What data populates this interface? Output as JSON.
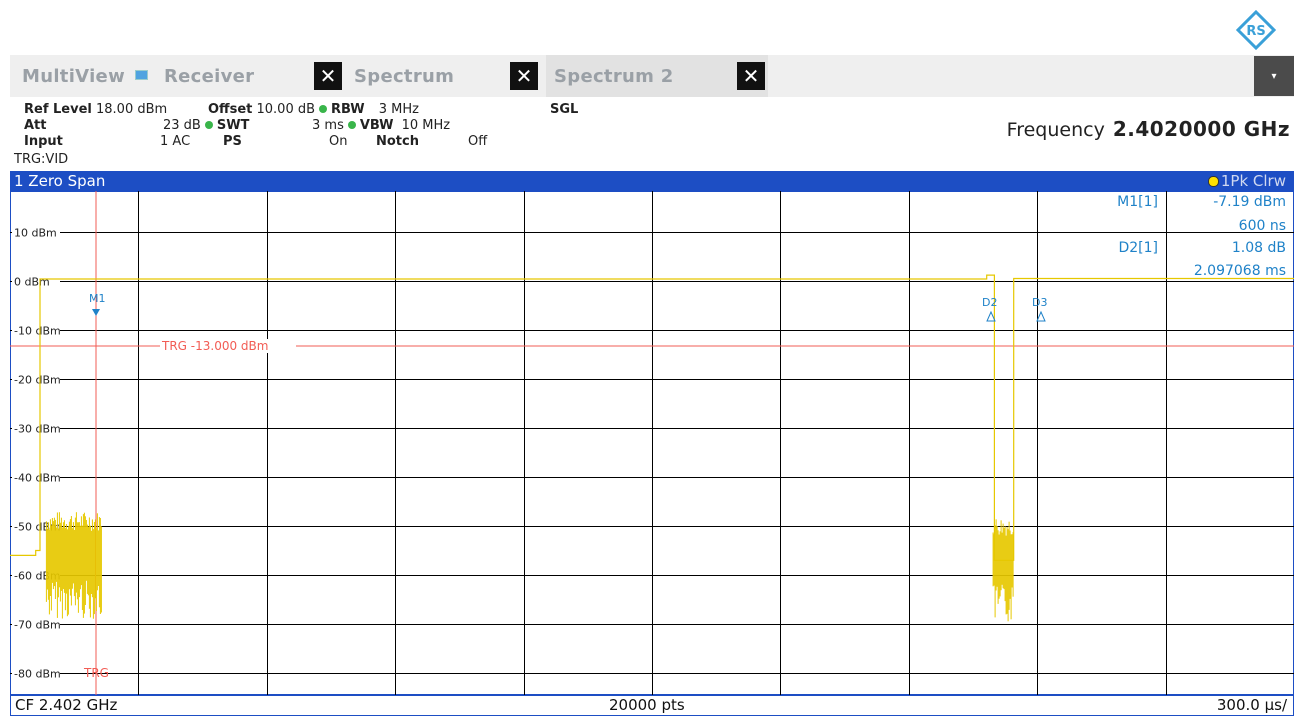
{
  "tabs": [
    {
      "label": "MultiView",
      "active": false
    },
    {
      "label": "Receiver",
      "active": false
    },
    {
      "label": "Spectrum",
      "active": false
    },
    {
      "label": "Spectrum 2",
      "active": true
    }
  ],
  "settings": {
    "ref_level_label": "Ref Level",
    "ref_level_value": "18.00 dBm",
    "offset_label": "Offset",
    "offset_value": "10.00 dB",
    "rbw_label": "RBW",
    "rbw_value": "3 MHz",
    "att_label": "Att",
    "att_value": "23 dB",
    "swt_label": "SWT",
    "swt_value": "3 ms",
    "vbw_label": "VBW",
    "vbw_value": "10 MHz",
    "input_label": "Input",
    "input_value": "1 AC",
    "ps_label": "PS",
    "ps_value": "On",
    "notch_label": "Notch",
    "notch_value": "Off",
    "sgl": "SGL",
    "trigger": "TRG:VID"
  },
  "frequency": {
    "label": "Frequency",
    "value": "2.4020000 GHz"
  },
  "diagram": {
    "title": "1 Zero Span",
    "trace": "1Pk Clrw"
  },
  "markers": {
    "m1_label": "M1[1]",
    "m1_level": "-7.19 dBm",
    "m1_time": "600 ns",
    "d2_label": "D2[1]",
    "d2_level": "1.08 dB",
    "d2_time": "2.097068 ms"
  },
  "plot_labels": {
    "y_ticks": [
      "10 dBm",
      "0 dBm",
      "-10 dBm",
      "-20 dBm",
      "-30 dBm",
      "-40 dBm",
      "-50 dBm",
      "-60 dBm",
      "-70 dBm",
      "-80 dBm"
    ],
    "trigger_line": "TRG  -13.000 dBm",
    "trigger_marker": "TRG",
    "m1": "M1",
    "d2": "D2",
    "d3": "D3"
  },
  "footer": {
    "cf": "CF 2.402 GHz",
    "points": "20000 pts",
    "scale": "300.0 µs/"
  },
  "colors": {
    "trace": "#e6c800",
    "grid": "#000000",
    "trigger": "#f25c54",
    "marker": "#1f82c8",
    "bar": "#1d4ec4"
  },
  "chart_data": {
    "type": "line",
    "title": "1 Zero Span",
    "xlabel": "",
    "ylabel": "",
    "ylim": [
      -82,
      18
    ],
    "x_unit": "ms",
    "xlim": [
      0,
      3
    ],
    "y_ticks": [
      10,
      0,
      -10,
      -20,
      -30,
      -40,
      -50,
      -60,
      -70,
      -80
    ],
    "trigger_level_dbm": -13,
    "series": [
      {
        "name": "1Pk Clrw",
        "segments": [
          {
            "x": [
              0,
              0.06,
              0.06,
              0.07,
              0.07,
              0.085,
              0.085,
              2.282,
              2.282,
              2.3,
              2.3,
              2.345,
              2.345,
              3.0
            ],
            "y": [
              -56,
              -56,
              -55,
              -55,
              0.4,
              0.4,
              0.4,
              0.4,
              1.2,
              1.2,
              -57,
              -57,
              0.5,
              0.5
            ]
          }
        ]
      }
    ],
    "markers": [
      {
        "name": "M1",
        "x": 0.0006,
        "y": -7.19
      },
      {
        "name": "D2",
        "x": 2.2976,
        "delta_db": 1.08
      },
      {
        "name": "D3",
        "x": 2.35
      }
    ]
  }
}
